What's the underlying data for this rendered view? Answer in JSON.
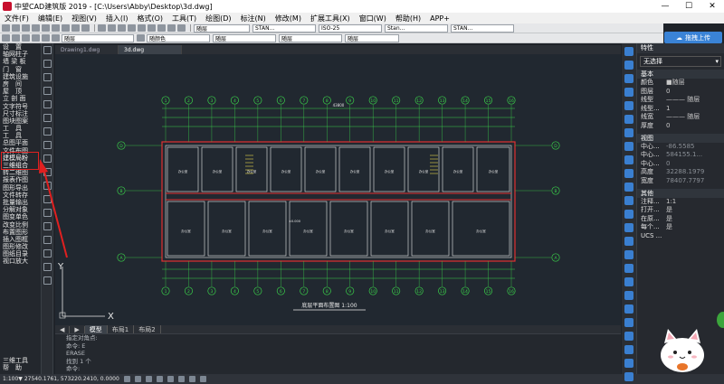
{
  "titlebar": {
    "title": "中望CAD建筑版 2019 - [C:\\Users\\Abby\\Desktop\\3d.dwg]",
    "minimize": "—",
    "maximize": "☐",
    "close": "✕"
  },
  "menu": [
    "文件(F)",
    "编辑(E)",
    "视图(V)",
    "插入(I)",
    "格式(O)",
    "工具(T)",
    "绘图(D)",
    "标注(N)",
    "修改(M)",
    "扩展工具(X)",
    "窗口(W)",
    "帮助(H)",
    "APP+"
  ],
  "toolbar": {
    "layer_combo": "随层",
    "linetype_combo": "随层",
    "dimstyle_combo": "ISO-25",
    "textstyle_combo": "STAN...",
    "style2_combo": "Stan...",
    "style3_combo": "STAN...",
    "layer2_combo": "随层",
    "linetype2_combo": "随层",
    "lineweight_combo": "随层",
    "color_combo": "随颜色"
  },
  "left_panel": {
    "items": [
      "设　置",
      "轴网柱子",
      "墙 梁 板",
      "门　窗",
      "建筑设施",
      "房　间",
      "屋　顶",
      "立 剖 面",
      "文字符号",
      "尺寸标注",
      "图块图案",
      "工　具",
      "工　具",
      "总图平面",
      "文件布图",
      "建模局粉",
      "三维组合",
      "转二维图",
      "报表作图",
      "图形导出",
      "文件转存",
      "批量输出",
      "分解对象",
      "图变单色",
      "改变比例",
      "布置图形",
      "插入图框",
      "图形修改",
      "图纸目录",
      "视口放大"
    ],
    "bottom": [
      "三维工具",
      "帮　助"
    ]
  },
  "doc_tabs": [
    "Drawing1.dwg",
    "3d.dwg"
  ],
  "layout_tabs": [
    "模型",
    "布局1",
    "布局2"
  ],
  "command_lines": [
    "指定对角点:",
    "命令: E",
    "ERASE",
    "找到 1 个",
    "命令:"
  ],
  "status": {
    "coords": "1:100▼ 27540.1761, 573220.2410, 0.0000"
  },
  "props": {
    "title": "特性",
    "selection": "无选择",
    "basic_label": "基本",
    "basic": [
      {
        "k": "颜色",
        "v": "■随层"
      },
      {
        "k": "图层",
        "v": "0"
      },
      {
        "k": "线型",
        "v": "——— 随层"
      },
      {
        "k": "线型...",
        "v": "1"
      },
      {
        "k": "线宽",
        "v": "——— 随层"
      },
      {
        "k": "厚度",
        "v": "0"
      }
    ],
    "view_label": "视图",
    "view": [
      {
        "k": "中心...",
        "v": "-86.5585"
      },
      {
        "k": "中心...",
        "v": "584155.1..."
      },
      {
        "k": "中心...",
        "v": "0"
      },
      {
        "k": "高度",
        "v": "32288.1979"
      },
      {
        "k": "宽度",
        "v": "78407.7797"
      }
    ],
    "other_label": "其他",
    "other": [
      {
        "k": "注释...",
        "v": "1:1"
      },
      {
        "k": "打开...",
        "v": "是"
      },
      {
        "k": "在原...",
        "v": "是"
      },
      {
        "k": "每个...",
        "v": "是"
      },
      {
        "k": "UCS ...",
        "v": ""
      }
    ]
  },
  "drag_button": "拖拽上传",
  "drawing": {
    "plan_title": "底层平面布置图 1:100",
    "total_width_dim": "43800",
    "top_axes": [
      "1",
      "2",
      "3",
      "4",
      "5",
      "6",
      "7",
      "8",
      "9",
      "10",
      "11",
      "12",
      "13",
      "14",
      "15",
      "16"
    ],
    "bottom_axes": [
      "1",
      "2",
      "3",
      "4",
      "5",
      "6",
      "7",
      "8",
      "9",
      "10",
      "11",
      "12",
      "13",
      "14",
      "15",
      "16"
    ],
    "left_axes": [
      "D",
      "B",
      "A"
    ],
    "right_axes": [
      "D",
      "B",
      "A"
    ],
    "elevation_label": "±0.000",
    "room_label": "办公室",
    "room_code": "M-1",
    "ucs_x": "X",
    "ucs_y": "Y"
  },
  "colors": {
    "accent": "#3a83d6",
    "highlight": "#e02020",
    "drawing_bg": "#212830"
  }
}
